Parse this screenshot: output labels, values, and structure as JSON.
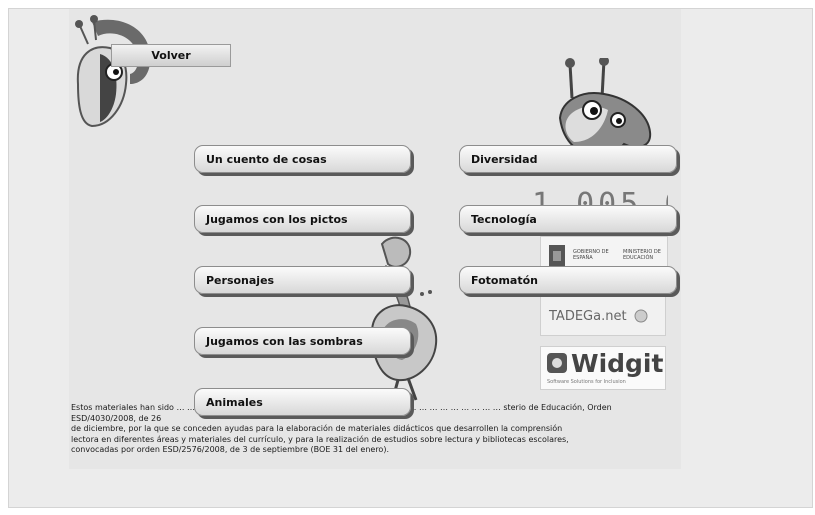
{
  "nav": {
    "back_label": "Volver"
  },
  "menu": {
    "left": [
      {
        "label": "Un cuento de cosas"
      },
      {
        "label": "Jugamos con los pictos"
      },
      {
        "label": "Personajes"
      },
      {
        "label": "Jugamos con las sombras"
      },
      {
        "label": "Animales"
      }
    ],
    "right": [
      {
        "label": "Diversidad"
      },
      {
        "label": "Tecnología"
      },
      {
        "label": "Fotomatón"
      }
    ]
  },
  "logos": {
    "date_text": "1.005.06",
    "ministry_line1": "GOBIERNO DE ESPAÑA",
    "ministry_line2": "MINISTERIO DE EDUCACIÓN",
    "tadega": "TADEGa.net",
    "widgit": "Widgit",
    "widgit_tagline": "Software Solutions for Inclusion"
  },
  "footer": {
    "text": "Estos materiales han sido … … … … … … … … … … … … … … … … … … … … … … … … … … … … … … … sterio de Educación, Orden ESD/4030/2008, de 26\nde diciembre, por la que se conceden ayudas para la elaboración de materiales didácticos que desarrollen la comprensión\nlectora en diferentes áreas y materiales del currículo, y para la realización de estudios sobre lectura y bibliotecas escolares,\nconvocadas por orden ESD/2576/2008, de 3 de septiembre (BOE 31 del enero)."
  }
}
